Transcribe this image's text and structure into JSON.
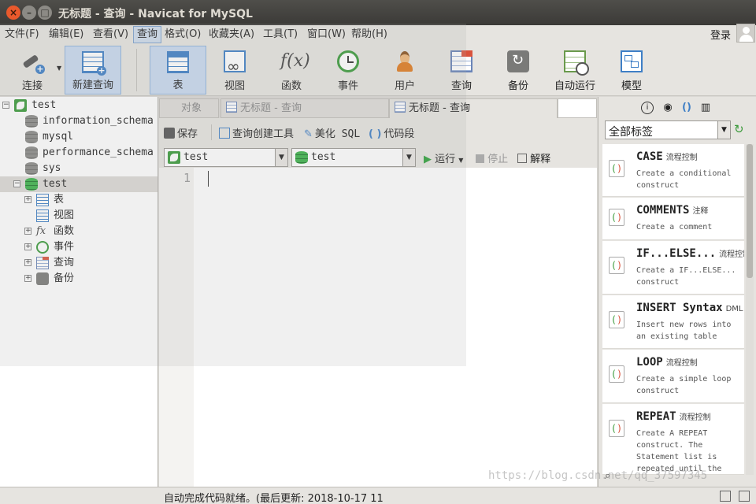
{
  "window": {
    "title": "无标题 - 查询 - Navicat for MySQL"
  },
  "menu": {
    "items": [
      "文件(F)",
      "编辑(E)",
      "查看(V)",
      "查询",
      "格式(O)",
      "收藏夹(A)",
      "工具(T)",
      "窗口(W)",
      "帮助(H)"
    ],
    "active": "查询",
    "login": "登录"
  },
  "toolbar": {
    "connect": "连接",
    "new_query": "新建查询",
    "table": "表",
    "view": "视图",
    "function": "函数",
    "event": "事件",
    "user": "用户",
    "query": "查询",
    "backup": "备份",
    "auto_run": "自动运行",
    "model": "模型"
  },
  "tree": {
    "connection": "test",
    "databases": [
      "information_schema",
      "mysql",
      "performance_schema",
      "sys",
      "test"
    ],
    "selected_db": "test",
    "children": [
      "表",
      "视图",
      "函数",
      "事件",
      "查询",
      "备份"
    ]
  },
  "tabs": {
    "objects": "对象",
    "untitled_1": "无标题 - 查询",
    "untitled_2": "无标题 - 查询"
  },
  "query_toolbar": {
    "save": "保存",
    "builder": "查询创建工具",
    "beautify": "美化 SQL",
    "snippet": "代码段",
    "run": "运行",
    "stop": "停止",
    "explain": "解释"
  },
  "selectors": {
    "connection": "test",
    "database": "test"
  },
  "editor": {
    "line_number": "1"
  },
  "right_panel": {
    "tag_filter": "全部标签",
    "snippets": [
      {
        "title": "CASE",
        "tag": "流程控制",
        "desc": "Create a conditional construct"
      },
      {
        "title": "COMMENTS",
        "tag": "注释",
        "desc": "Create a comment"
      },
      {
        "title": "IF...ELSE...",
        "tag": "流程控制",
        "desc": "Create a IF...ELSE... construct"
      },
      {
        "title": "INSERT Syntax",
        "tag": "DML",
        "desc": "Insert new rows into an existing table"
      },
      {
        "title": "LOOP",
        "tag": "流程控制",
        "desc": "Create a simple loop construct"
      },
      {
        "title": "REPEAT",
        "tag": "流程控制",
        "desc": "Create A REPEAT construct. The Statement list is repeated until the"
      }
    ]
  },
  "status": {
    "text": "自动完成代码就绪。(最后更新: 2018-10-17 11"
  },
  "watermark": "https://blog.csdn.net/qq_37597345"
}
